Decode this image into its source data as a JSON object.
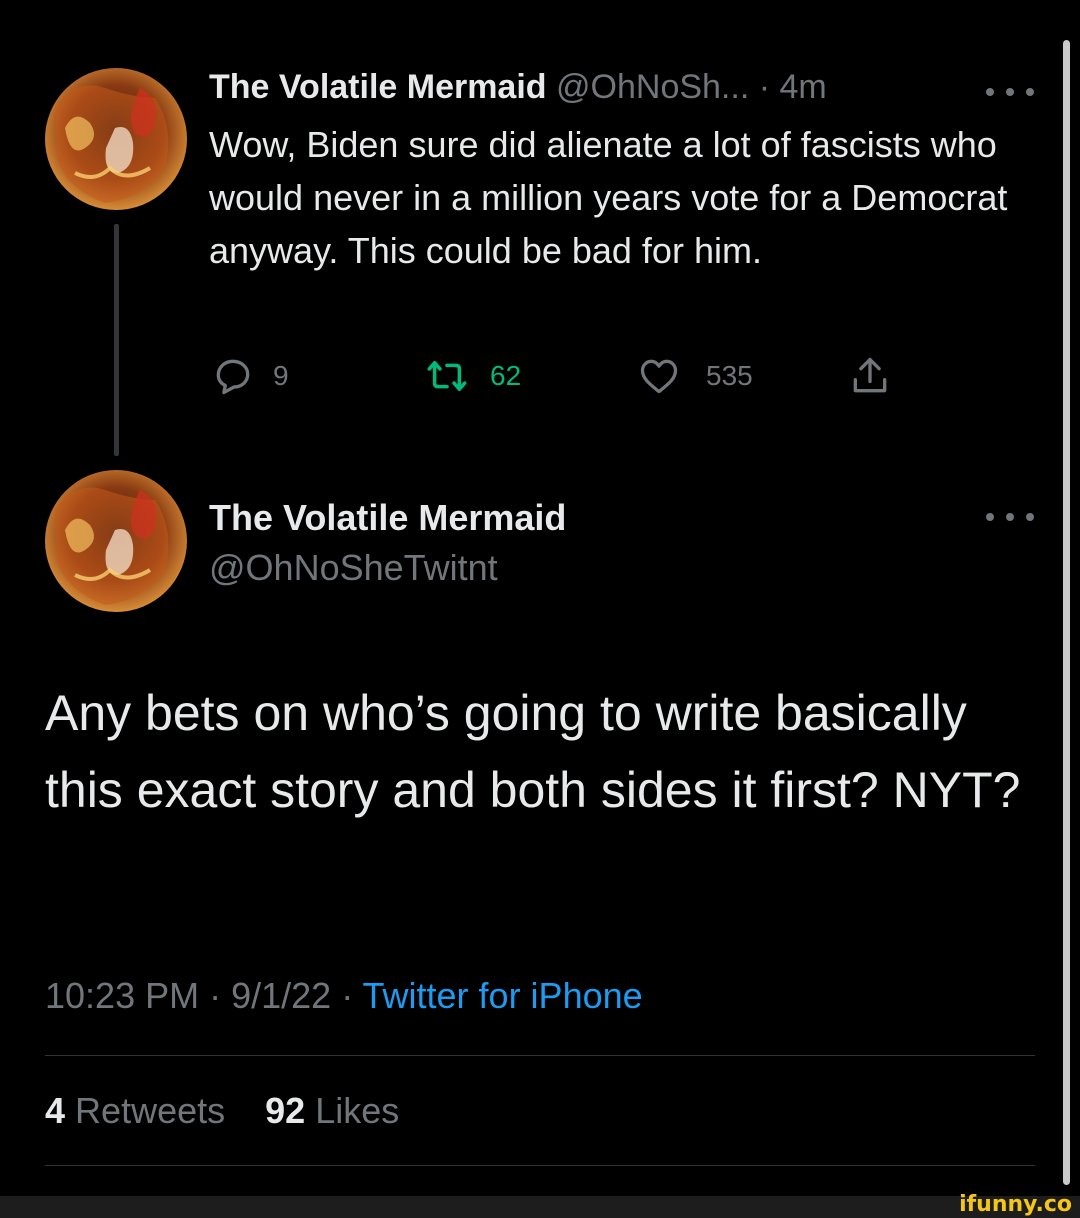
{
  "reply_context": {
    "display_name": "The Volatile Mermaid",
    "handle_truncated": "@OhNoSh...",
    "separator": "·",
    "time_ago": "4m",
    "body": "Wow, Biden sure did alienate a lot of fascists who would never in a million years vote for a Democrat anyway. This could be bad for him.",
    "actions": {
      "replies": "9",
      "retweets": "62",
      "likes": "535"
    },
    "icons": [
      "reply-icon",
      "retweet-icon",
      "like-icon",
      "share-icon",
      "more-options-icon"
    ],
    "colors": {
      "retweet_accent": "#00ba7c"
    }
  },
  "tweet": {
    "display_name": "The Volatile Mermaid",
    "handle": "@OhNoSheTwitnt",
    "body": "Any bets on who’s going to write basically this exact story and both sides it first? NYT?",
    "time": "10:23 PM",
    "date": "9/1/22",
    "sep1": " · ",
    "sep2": " · ",
    "source": "Twitter for iPhone",
    "retweet_count": "4",
    "retweet_label": "Retweets",
    "like_count": "92",
    "like_label": "Likes",
    "colors": {
      "link": "#1d9bf0",
      "muted": "#71767b",
      "text": "#e7e9ea"
    }
  },
  "watermark": "ifunny.co"
}
